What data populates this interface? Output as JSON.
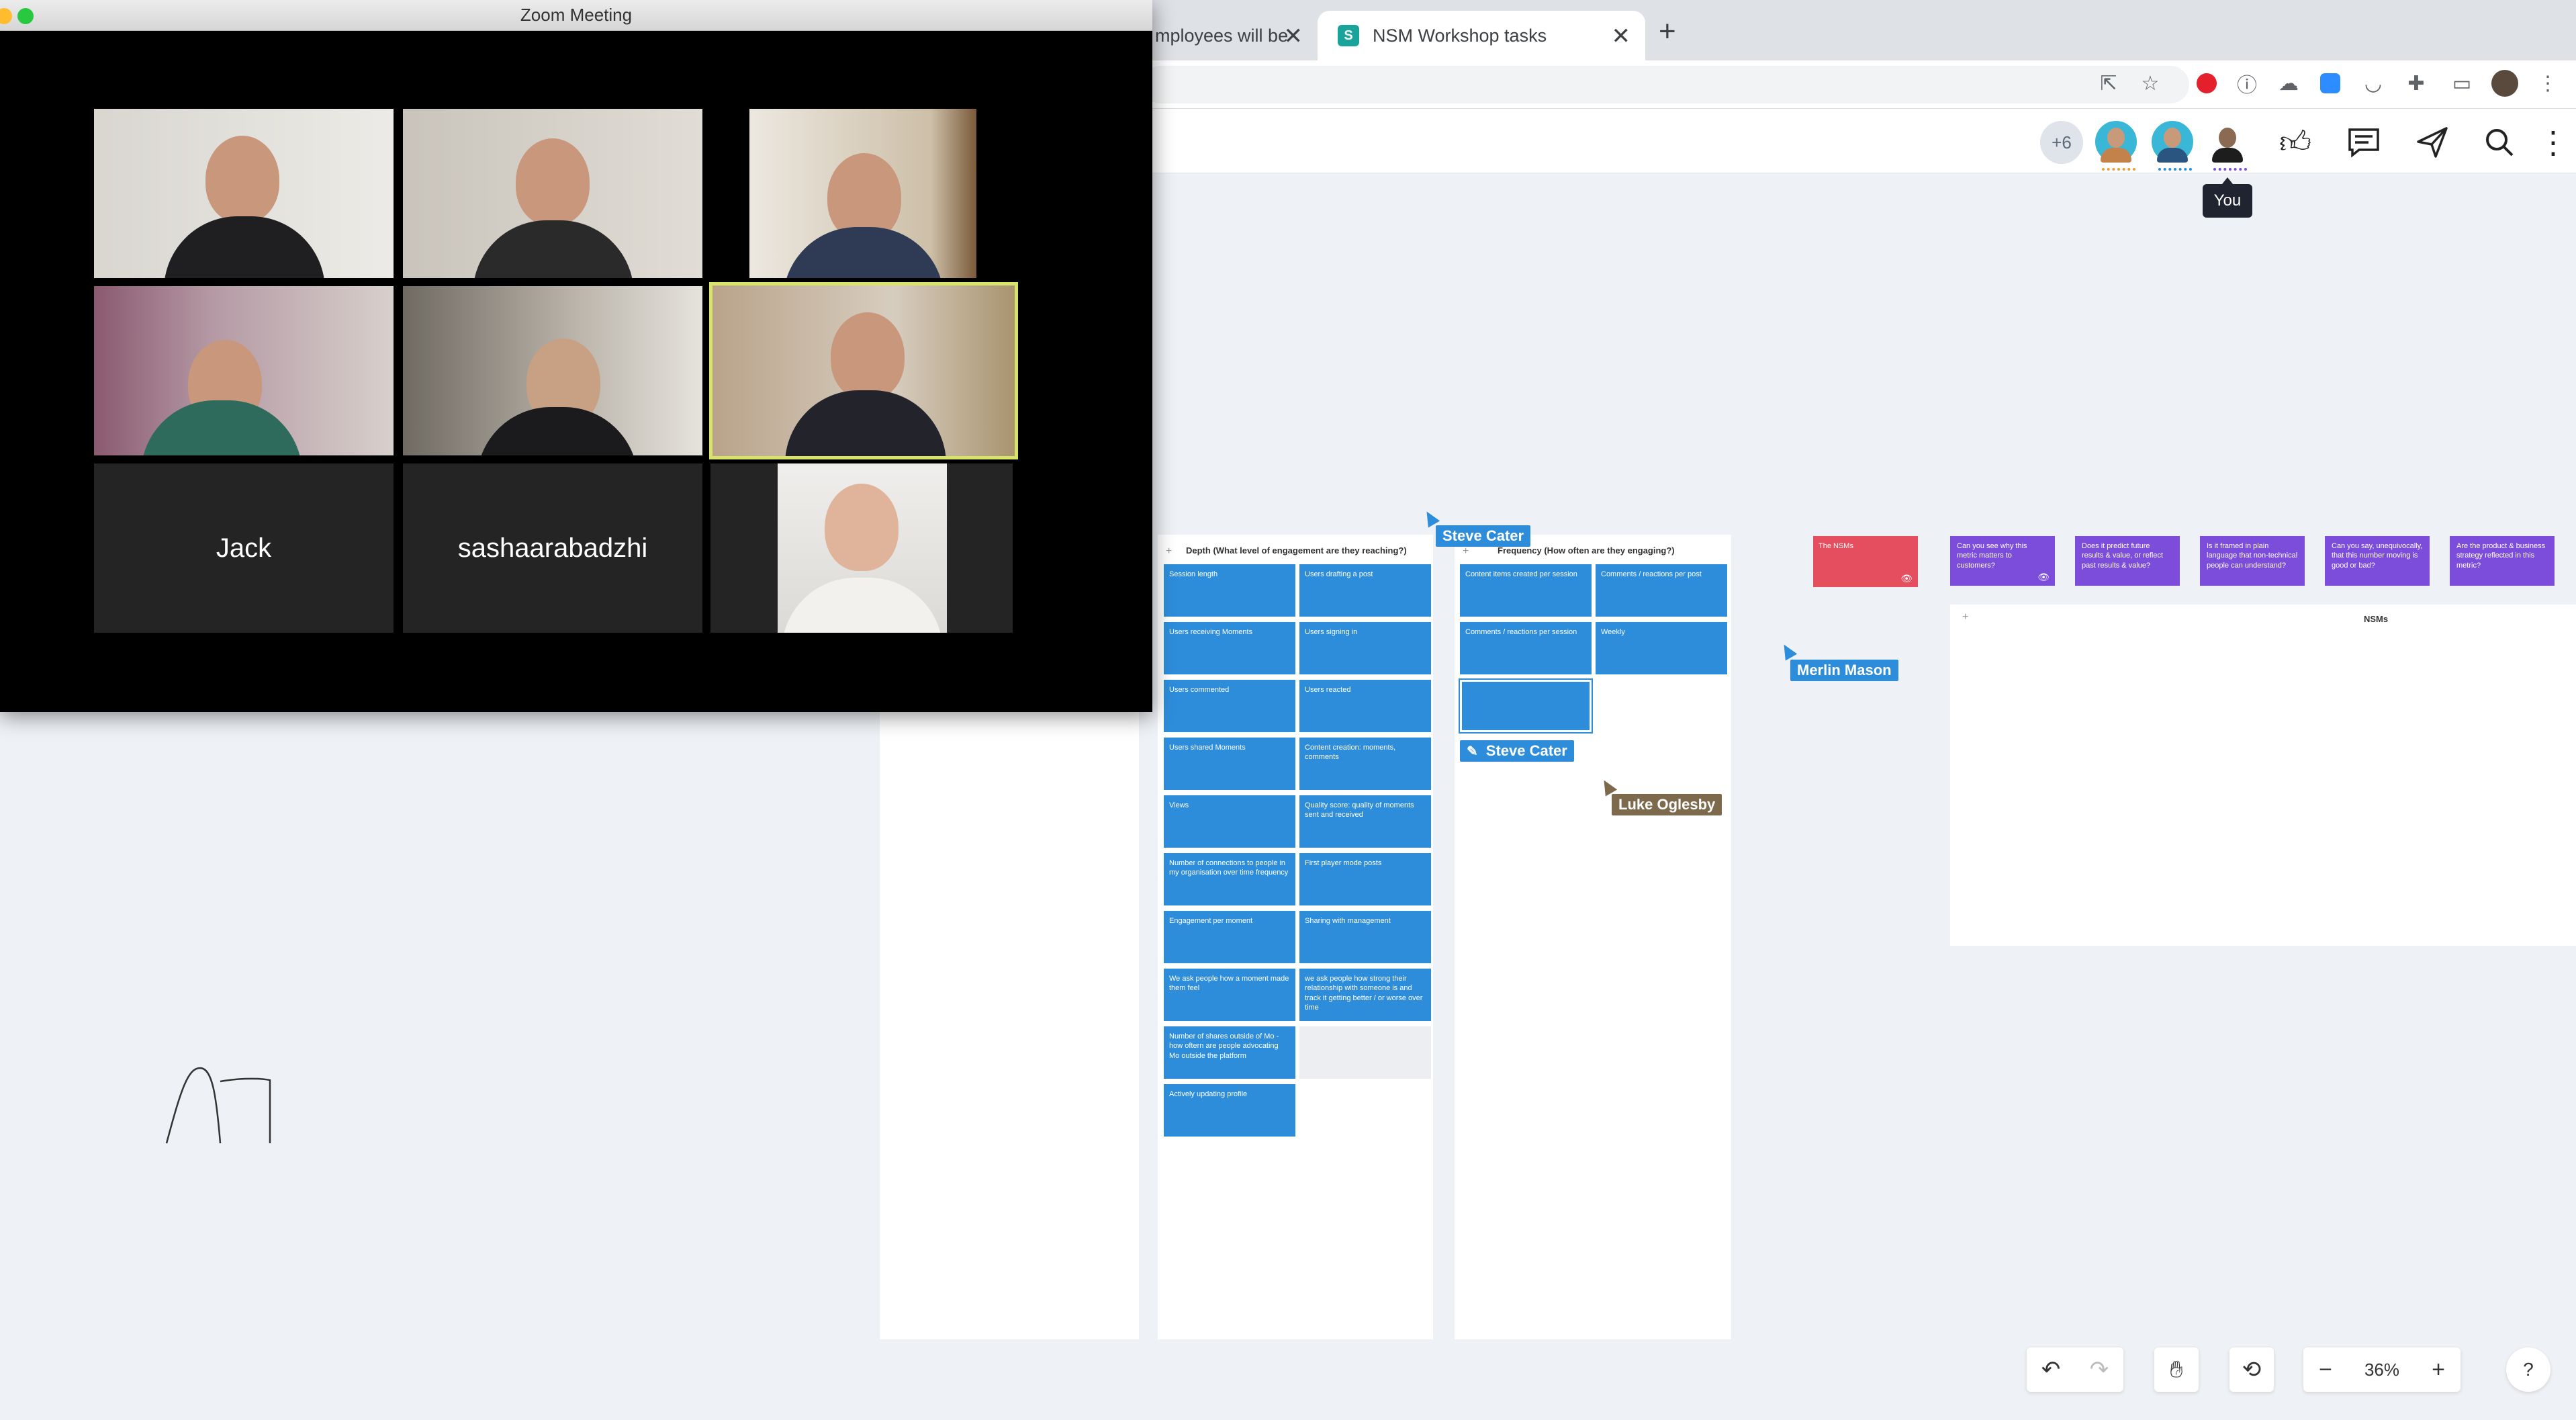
{
  "browser": {
    "tabs": [
      {
        "label": "mployees will be"
      },
      {
        "label": "NSM Workshop tasks",
        "favicon": "S"
      }
    ],
    "new_tab": "+"
  },
  "app": {
    "collaborators_more": "+6",
    "you_tooltip": "You"
  },
  "board": {
    "columns": [
      {
        "title": "Depth (What level of engagement are they reaching?)"
      },
      {
        "title": "Frequency (How often are they engaging?)"
      }
    ],
    "depth_left": [
      "Session length",
      "Users receiving Moments",
      "Users commented",
      "Users shared Moments",
      "Views",
      "Number of connections to people in my organisation over time frequency",
      "Engagement per moment",
      "We ask people how a moment made them feel",
      "Number of shares outside of Mo - how oftern are people advocating Mo outside the platform",
      "Actively updating profile"
    ],
    "depth_right": [
      "Users drafting a post",
      "Users signing in",
      "Users reacted",
      "Content creation: moments, comments",
      "Quality score: quality of moments sent and received",
      "First player mode posts",
      "Sharing with management",
      "we ask people how strong their relationship with someone is and track it getting better / or worse over time"
    ],
    "frequency": [
      "Content items created per session",
      "Comments / reactions per post",
      "Comments / reactions per session",
      "Weekly"
    ],
    "nsm_red": "The NSMs",
    "nsm_questions": [
      "Can you see why this metric matters to customers?",
      "Does it predict future results & value, or reflect past results & value?",
      "Is it framed in plain language that non-technical people can understand?",
      "Can you say, unequivocally, that this number moving is good or bad?",
      "Are the product & business strategy reflected in this metric?"
    ],
    "nsms_frame_title": "NSMs",
    "cursors": {
      "steve_top": "Steve Cater",
      "steve_edit": "Steve Cater",
      "merlin": "Merlin Mason",
      "luke": "Luke Oglesby"
    },
    "zoom_level": "36%",
    "help": "?"
  },
  "zoom": {
    "title": "Zoom Meeting",
    "name_tiles": [
      "Jack",
      "sashaarabadzhi"
    ]
  },
  "colors": {
    "sticky_blue": "#2d8ddb",
    "sticky_purple": "#7c4ddb",
    "sticky_red": "#e44e5e",
    "active_speaker": "#d8e36a"
  }
}
